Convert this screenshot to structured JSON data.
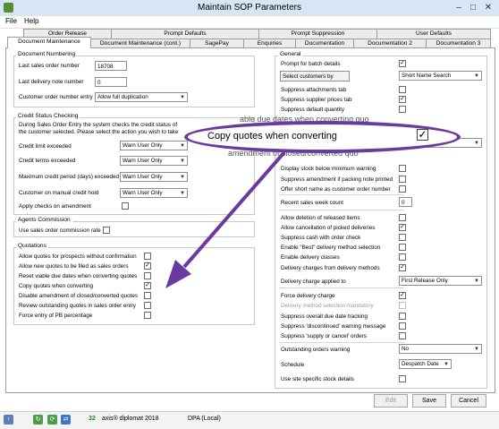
{
  "window": {
    "title": "Maintain SOP Parameters"
  },
  "menu": [
    "File",
    "Help"
  ],
  "tabs_top": [
    "Order Release",
    "Prompt Defaults",
    "Prompt Suppression",
    "User Defaults"
  ],
  "tabs_bottom": [
    "Document Maintenance",
    "Document Maintenance (cont.)",
    "SagePay",
    "Enquiries",
    "Documentation",
    "Documentation 2",
    "Documentation 3"
  ],
  "doc_numbering": {
    "title": "Document Numbering",
    "last_sales_order_label": "Last sales order number",
    "last_sales_order_value": "18708",
    "last_delivery_note_label": "Last delivery note number",
    "last_delivery_note_value": "0",
    "customer_order_entry_label": "Customer order number entry",
    "customer_order_entry_value": "Allow full duplication"
  },
  "credit": {
    "title": "Credit Status Checking",
    "desc1": "During Sales Order Entry the system checks the credit status of",
    "desc2": "the customer selected. Please select the action you wish to take",
    "rows": [
      {
        "label": "Credit limit exceeded",
        "value": "Warn User Only"
      },
      {
        "label": "Credit terms exceeded",
        "value": "Warn User Only"
      },
      {
        "label": "Maximum credit period (days) exceeded",
        "value": "Warn User Only"
      },
      {
        "label": "Customer on manual credit hold",
        "value": "Warn User Only"
      }
    ],
    "apply_label": "Apply checks on amendment"
  },
  "agents": {
    "title": "Agents Commission",
    "use_rate_label": "Use sales order commission rate"
  },
  "quotations": {
    "title": "Quotations",
    "items": [
      {
        "label": "Allow quotes for prospects without confirmation",
        "checked": ""
      },
      {
        "label": "Allow new quotes to be filed as sales orders",
        "checked": "✓"
      },
      {
        "label": "Reset viable due dates when converting quotes",
        "checked": ""
      },
      {
        "label": "Copy quotes when converting",
        "checked": "✓"
      },
      {
        "label": "Disable amendment of closed/converted quotes",
        "checked": ""
      },
      {
        "label": "Review outstanding quotes in sales order entry",
        "checked": ""
      },
      {
        "label": "Force entry of PB percentage",
        "checked": ""
      }
    ]
  },
  "general": {
    "title": "General",
    "prompt_batch_label": "Prompt for batch details",
    "prompt_batch_checked": "✓",
    "select_customers_label": "Select customers by",
    "select_customers_value": "Short Name Search",
    "items_a": [
      {
        "label": "Suppress attachments tab",
        "checked": ""
      },
      {
        "label": "Suppress supplier prices tab",
        "checked": "✓"
      },
      {
        "label": "Suppress default quantity",
        "checked": ""
      }
    ],
    "items_b": [
      {
        "label": "Display stock below minimum warning",
        "checked": ""
      },
      {
        "label": "Suppress amendment if packing note printed",
        "checked": ""
      },
      {
        "label": "Offer short name as customer order number",
        "checked": ""
      }
    ],
    "recent_week_label": "Recent sales week count",
    "recent_week_value": "0",
    "items_c": [
      {
        "label": "Allow deletion of released items",
        "checked": ""
      },
      {
        "label": "Allow cancellation of picked deliveries",
        "checked": "✓"
      },
      {
        "label": "Suppress cash with order check",
        "checked": ""
      },
      {
        "label": "Enable \"Best\" delivery method selection",
        "checked": ""
      },
      {
        "label": "Enable delivery classes",
        "checked": ""
      },
      {
        "label": "Delivery charges from delivery methods",
        "checked": "✓"
      }
    ],
    "delivery_applied_label": "Delivery charge applied to",
    "delivery_applied_value": "First Release Only",
    "force_delivery_label": "Force delivery charge",
    "force_delivery_checked": "✓",
    "delivery_mandatory_label": "Delivery method selection mandatory",
    "items_d": [
      {
        "label": "Suppress overall due date tracking",
        "checked": ""
      },
      {
        "label": "Suppress 'discontinued' warning message",
        "checked": ""
      },
      {
        "label": "Suppress 'supply or cancel' orders",
        "checked": ""
      }
    ],
    "outstanding_label": "Outstanding orders warning",
    "outstanding_value": "No",
    "schedule_label": "Schedule",
    "schedule_value": "Despatch Date",
    "site_stock_label": "Use site specific stock details"
  },
  "callout": {
    "text": "Copy quotes when converting",
    "checked": "✓",
    "peek_top": "able due dates when converting quo",
    "peek_bottom": "amendment of closed/converted quo"
  },
  "buttons": {
    "edit": "Edit",
    "save": "Save",
    "cancel": "Cancel"
  },
  "status": {
    "count": "32",
    "app": "axis® diplomat 2018",
    "company": "DPA (Local)"
  },
  "colors": {
    "callout": "#6a3b9e",
    "titlebar": "#d6e6f5"
  }
}
